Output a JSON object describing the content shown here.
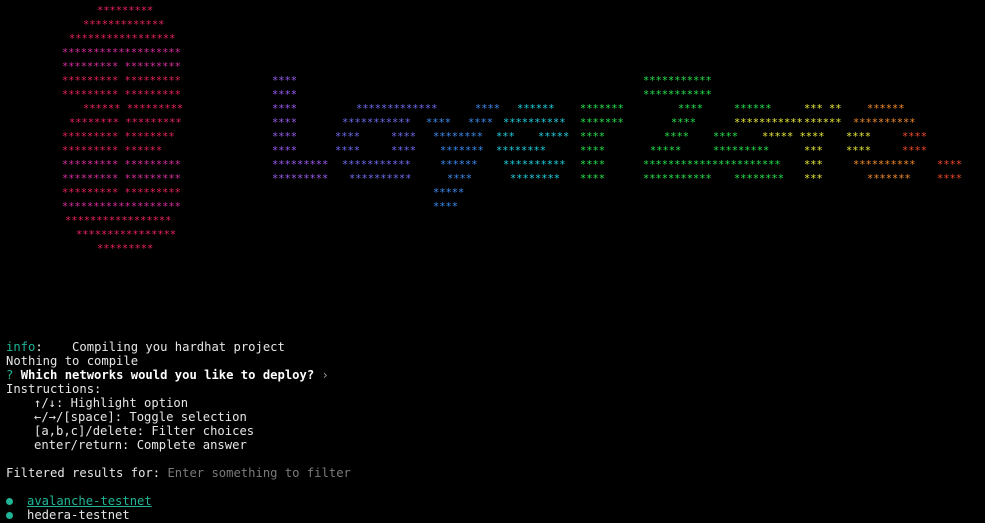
{
  "ascii_art": {
    "color_magenta": "#e6245c",
    "color_pink": "#d82e9e",
    "color_purple": "#9a5bf0",
    "color_indigo": "#6e6cf0",
    "color_blue": "#3b8cf0",
    "color_cyan": "#20d0e0",
    "color_green": "#25e04a",
    "color_yellow": "#e8e83a",
    "color_orange": "#f08a2a",
    "color_red": "#f04a2a"
  },
  "log": {
    "info_tag": "info",
    "info_colon": ":",
    "info_message": "    Compiling you hardhat project",
    "nothing_to_compile": "Nothing to compile",
    "question_mark": "?",
    "question": "Which networks would you like to deploy?",
    "question_chevron": "›",
    "instructions_title": "Instructions:",
    "instructions": [
      "↑/↓: Highlight option",
      "←/→/[space]: Toggle selection",
      "[a,b,c]/delete: Filter choices",
      "enter/return: Complete answer"
    ],
    "filter_label": "Filtered results for:",
    "filter_placeholder": "Enter something to filter",
    "choices": [
      {
        "label": "avalanche-testnet"
      },
      {
        "label": "hedera-testnet"
      }
    ]
  }
}
